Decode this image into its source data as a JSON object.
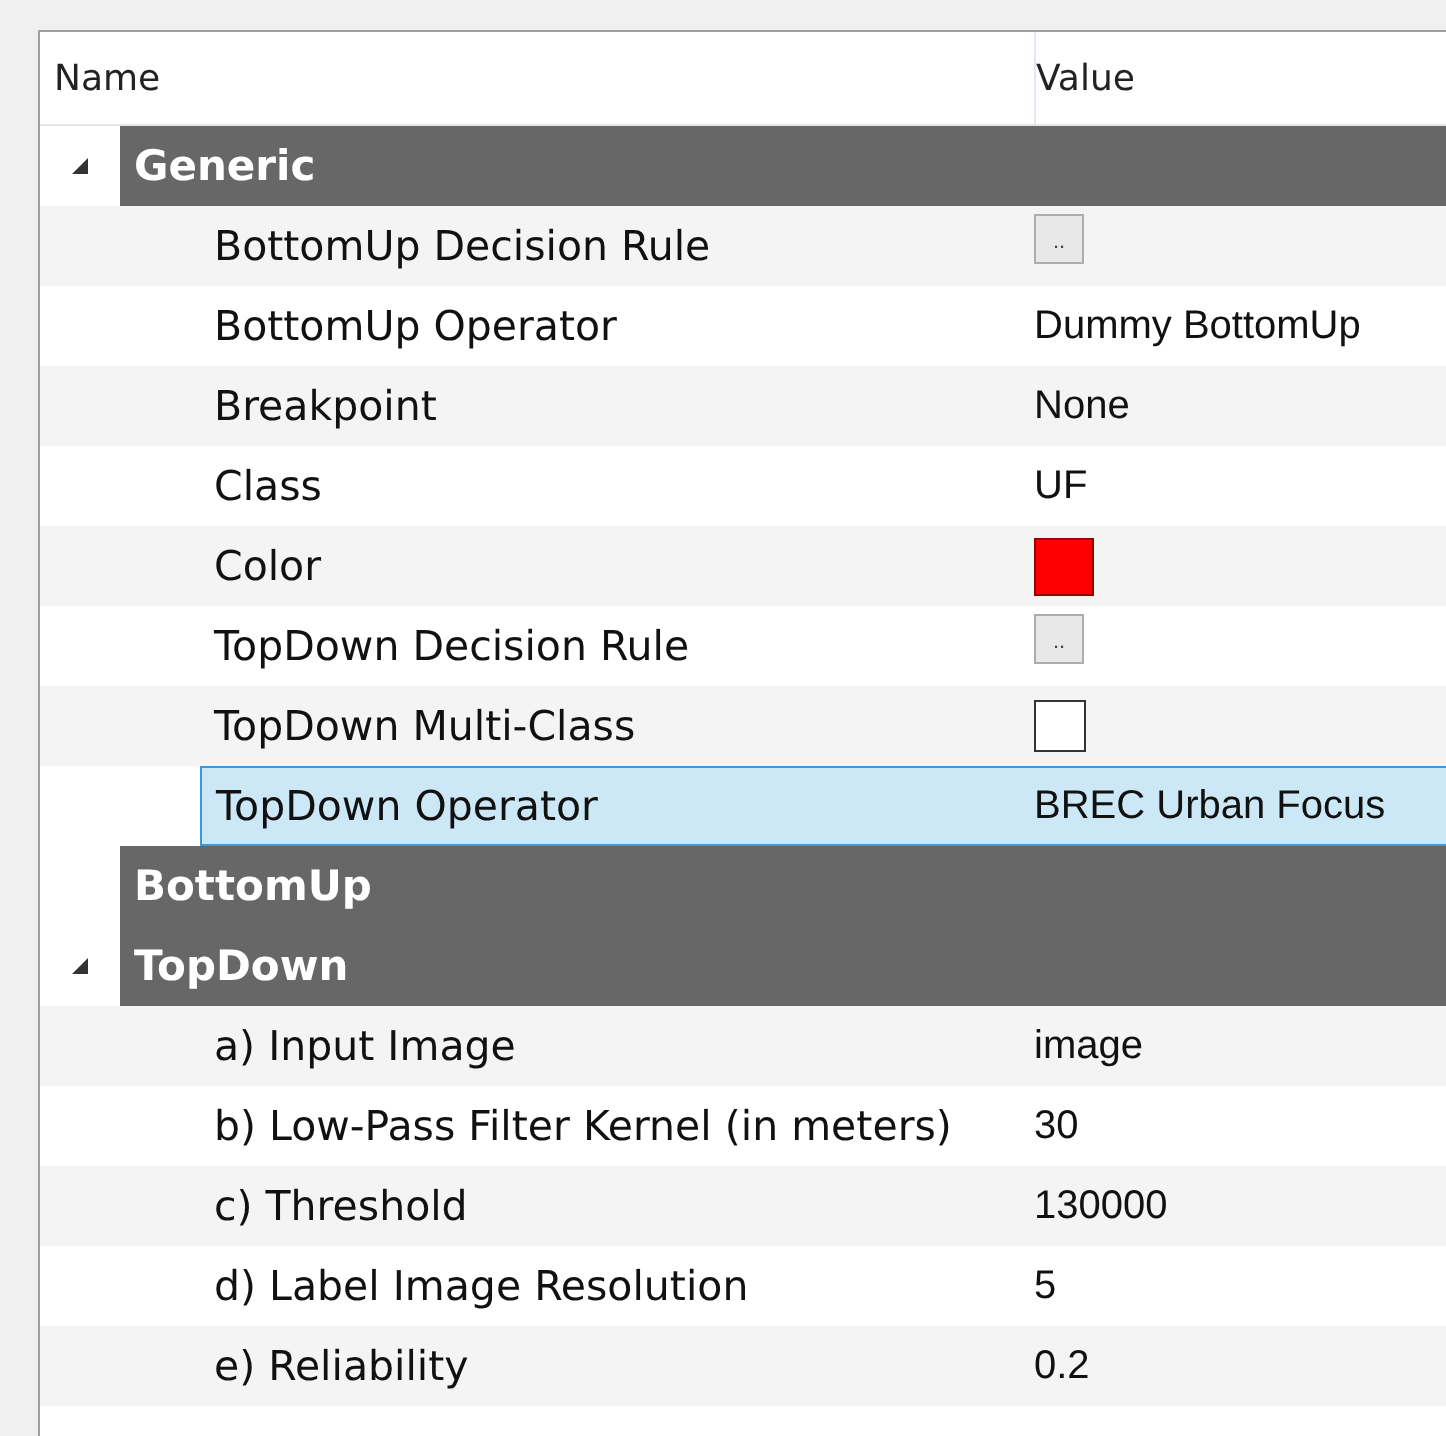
{
  "columns": [
    "Name",
    "Value"
  ],
  "categories": [
    {
      "title": "Generic",
      "expanded": true,
      "properties": [
        {
          "name": "BottomUp Decision Rule",
          "kind": "button",
          "value": "..",
          "selected": false
        },
        {
          "name": "BottomUp Operator",
          "kind": "text",
          "value": "Dummy BottomUp",
          "selected": false
        },
        {
          "name": "Breakpoint",
          "kind": "text",
          "value": "None",
          "selected": false
        },
        {
          "name": "Class",
          "kind": "text",
          "value": "UF",
          "selected": false
        },
        {
          "name": "Color",
          "kind": "color",
          "color": "#ff0000",
          "selected": false
        },
        {
          "name": "TopDown Decision Rule",
          "kind": "button",
          "value": "..",
          "selected": false
        },
        {
          "name": "TopDown Multi-Class",
          "kind": "checkbox",
          "checked": false,
          "selected": false
        },
        {
          "name": "TopDown Operator",
          "kind": "text",
          "value": "BREC Urban Focus",
          "selected": true
        }
      ]
    },
    {
      "title": "BottomUp"
    },
    {
      "title": "TopDown",
      "expanded": true,
      "properties": [
        {
          "name": "a) Input Image",
          "kind": "text",
          "value": "image",
          "selected": false
        },
        {
          "name": "b) Low-Pass Filter Kernel (in meters)",
          "kind": "text",
          "value": "30",
          "selected": false
        },
        {
          "name": "c) Threshold",
          "kind": "text",
          "value": "130000",
          "selected": false
        },
        {
          "name": "d) Label Image Resolution",
          "kind": "text",
          "value": "5",
          "selected": false
        },
        {
          "name": "e) Reliability",
          "kind": "text",
          "value": "0.2",
          "selected": false
        }
      ]
    }
  ]
}
